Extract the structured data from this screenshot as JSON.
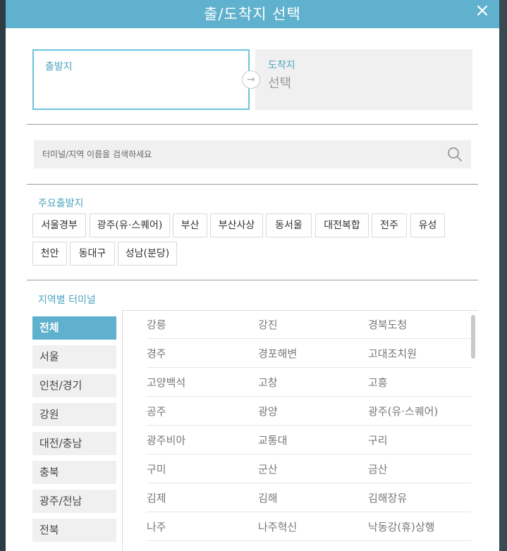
{
  "modal": {
    "title": "출/도착지 선택",
    "close_symbol": "×"
  },
  "route": {
    "origin_label": "출발지",
    "origin_value": "",
    "destination_label": "도착지",
    "destination_value": "선택",
    "arrow_symbol": "→"
  },
  "search": {
    "placeholder": "터미널/지역 이름을 검색하세요",
    "icon": "search-icon"
  },
  "major_origins": {
    "title": "주요출발지",
    "items": [
      "서울경부",
      "광주(유·스퀘어)",
      "부산",
      "부산사상",
      "동서울",
      "대전복합",
      "전주",
      "유성",
      "천안",
      "동대구",
      "성남(분당)"
    ]
  },
  "regional": {
    "title": "지역별 터미널",
    "regions": [
      "전체",
      "서울",
      "인천/경기",
      "강원",
      "대전/충남",
      "충북",
      "광주/전남",
      "전북"
    ],
    "active_region": "전체",
    "terminals": [
      [
        "강릉",
        "강진",
        "경북도청"
      ],
      [
        "경주",
        "경포해변",
        "고대조치원"
      ],
      [
        "고양백석",
        "고창",
        "고흥"
      ],
      [
        "공주",
        "광양",
        "광주(유·스퀘어)"
      ],
      [
        "광주비아",
        "교통대",
        "구리"
      ],
      [
        "구미",
        "군산",
        "금산"
      ],
      [
        "김제",
        "김해",
        "김해장유"
      ],
      [
        "나주",
        "나주혁신",
        "낙동강(휴)상행"
      ]
    ]
  },
  "colors": {
    "accent": "#5fb1cd",
    "label": "#4ea4c0",
    "panel_bg": "#f0f0f1"
  }
}
